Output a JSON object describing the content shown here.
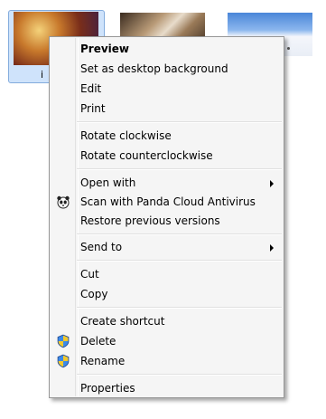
{
  "thumbnails": [
    {
      "caption": "i"
    },
    {
      "caption": ""
    },
    {
      "caption": ""
    }
  ],
  "menu": {
    "groups": [
      [
        {
          "label": "Preview",
          "bold": true
        },
        {
          "label": "Set as desktop background"
        },
        {
          "label": "Edit"
        },
        {
          "label": "Print"
        }
      ],
      [
        {
          "label": "Rotate clockwise"
        },
        {
          "label": "Rotate counterclockwise"
        }
      ],
      [
        {
          "label": "Open with",
          "submenu": true
        },
        {
          "label": "Scan with Panda Cloud Antivirus",
          "icon": "panda-icon"
        },
        {
          "label": "Restore previous versions"
        }
      ],
      [
        {
          "label": "Send to",
          "submenu": true
        }
      ],
      [
        {
          "label": "Cut"
        },
        {
          "label": "Copy"
        }
      ],
      [
        {
          "label": "Create shortcut"
        },
        {
          "label": "Delete",
          "icon": "uac-shield-icon"
        },
        {
          "label": "Rename",
          "icon": "uac-shield-icon"
        }
      ],
      [
        {
          "label": "Properties"
        }
      ]
    ]
  },
  "colors": {
    "selection_fill": "#cfe3fb",
    "selection_border": "#84acdd",
    "menu_bg": "#f5f5f5"
  }
}
